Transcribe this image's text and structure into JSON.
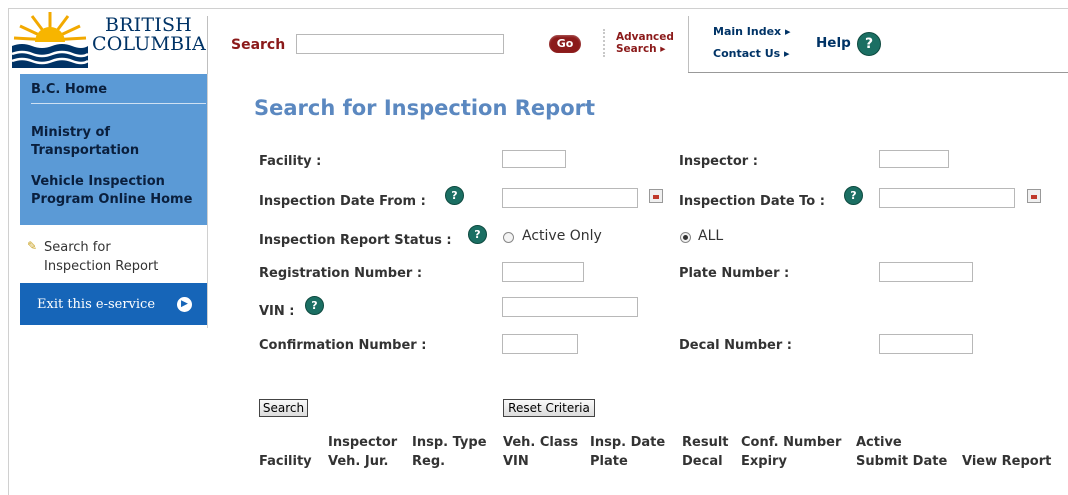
{
  "logo": {
    "line1": "BRITISH",
    "line2": "COLUMBIA"
  },
  "header": {
    "search_label": "Search",
    "search_value": "",
    "go_label": "Go",
    "advanced_line1": "Advanced",
    "advanced_line2": "Search ▸",
    "main_index": "Main Index ▸",
    "contact_us": "Contact Us ▸",
    "help": "Help"
  },
  "sidebar": {
    "home": "B.C. Home",
    "ministry_1": "Ministry of",
    "ministry_2": "Transportation",
    "vehicle_1": "Vehicle Inspection",
    "vehicle_2": "Program Online Home",
    "current_1": "Search for",
    "current_2": "Inspection Report",
    "exit": "Exit this e-service"
  },
  "page": {
    "title": "Search for Inspection Report"
  },
  "form": {
    "facility": "Facility :",
    "inspector": "Inspector :",
    "date_from": "Inspection Date From :",
    "date_to": "Inspection Date To :",
    "status": "Inspection Report Status :",
    "status_active": "Active Only",
    "status_all": "ALL",
    "status_selected": "ALL",
    "registration": "Registration Number :",
    "plate": "Plate Number :",
    "vin": "VIN :",
    "confirmation": "Confirmation Number :",
    "decal": "Decal Number :",
    "search_btn": "Search",
    "reset_btn": "Reset Criteria"
  },
  "results": {
    "columns": [
      {
        "top": "",
        "bottom": "Facility"
      },
      {
        "top": "Inspector",
        "bottom": "Veh. Jur."
      },
      {
        "top": "Insp. Type",
        "bottom": "Reg."
      },
      {
        "top": "Veh. Class",
        "bottom": "VIN"
      },
      {
        "top": "Insp. Date",
        "bottom": "Plate"
      },
      {
        "top": "Result",
        "bottom": "Decal"
      },
      {
        "top": "Conf. Number",
        "bottom": "Expiry"
      },
      {
        "top": "Active",
        "bottom": "Submit Date"
      },
      {
        "top": "",
        "bottom": "View Report"
      }
    ]
  },
  "icons": {
    "help": "help-question-icon",
    "calendar": "calendar-icon",
    "exit": "arrow-right-circle-icon",
    "current_page": "pencil-icon"
  },
  "colors": {
    "brand_red": "#8b1a1a",
    "sidebar_blue": "#5b9ad6",
    "exit_blue": "#1665b8",
    "title_blue": "#5b88c0",
    "help_green": "#1b6f63"
  }
}
